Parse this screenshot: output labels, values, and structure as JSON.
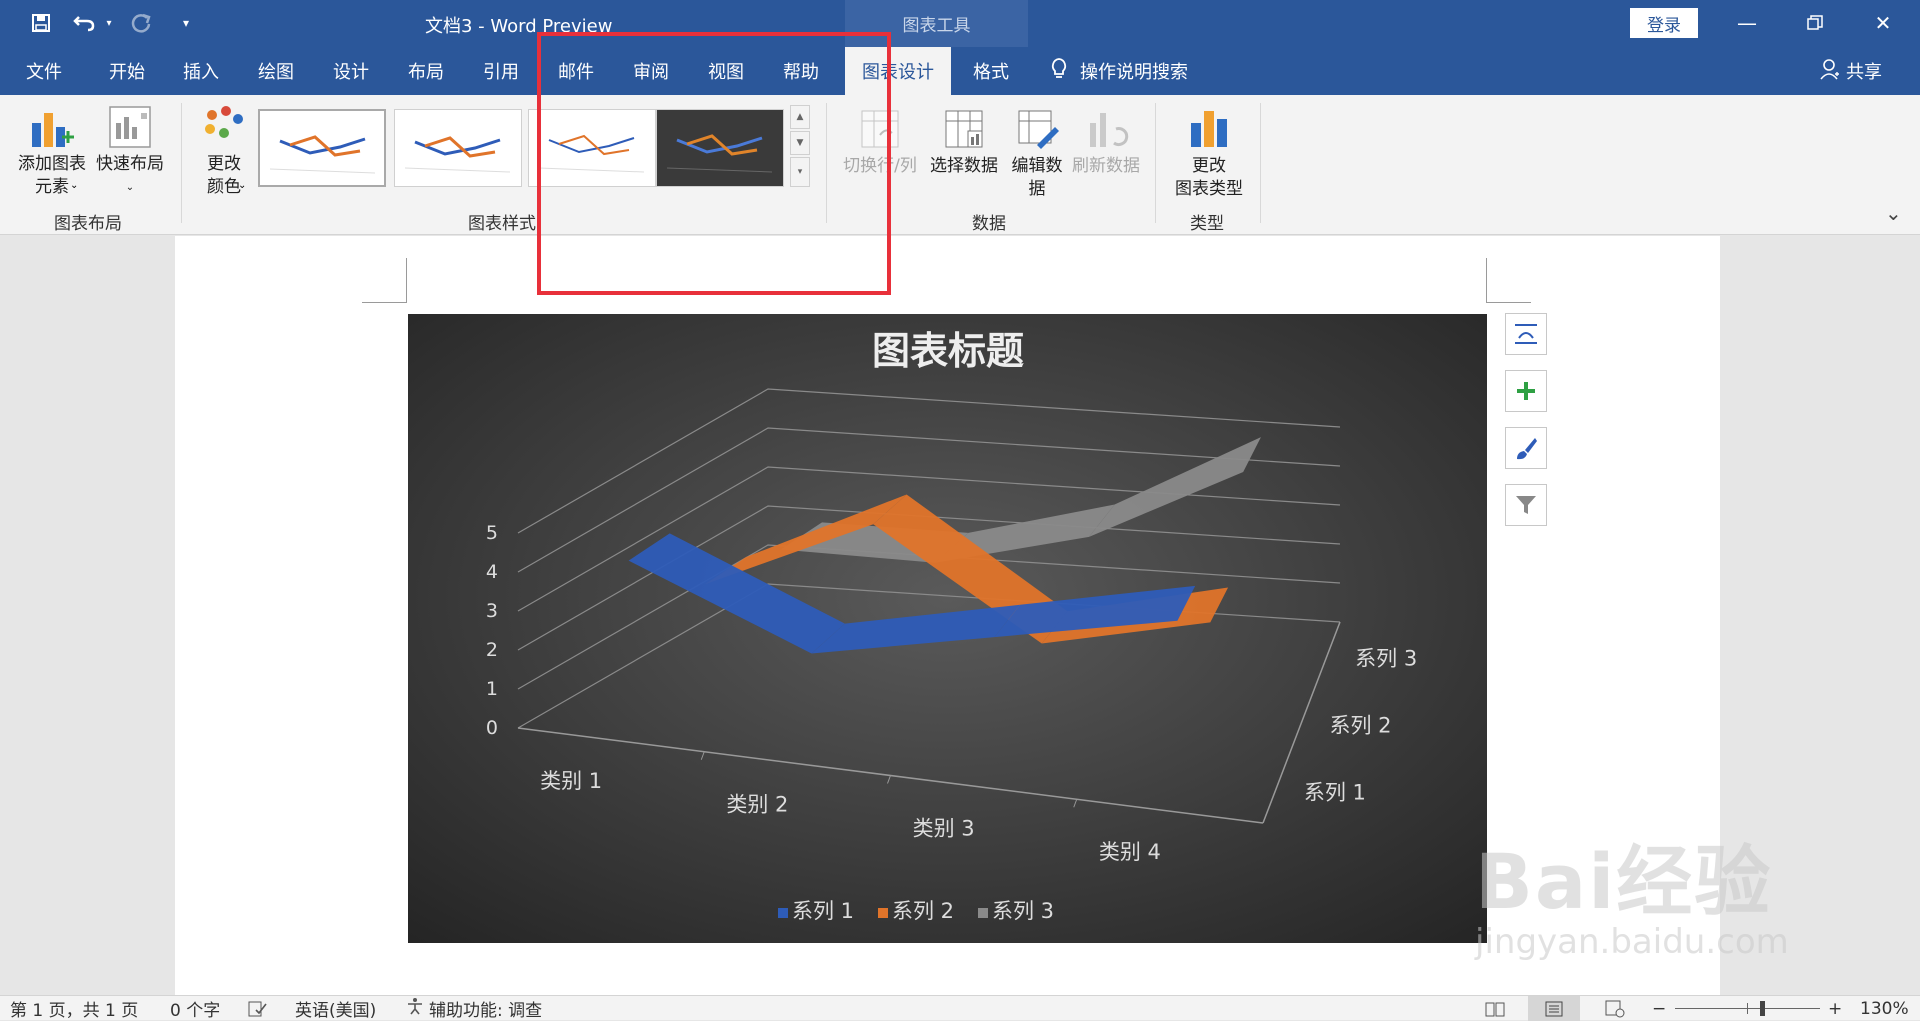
{
  "window": {
    "title": "文档3  -  Word Preview",
    "context_tab_group": "图表工具",
    "login_label": "登录"
  },
  "tabs": [
    "文件",
    "开始",
    "插入",
    "绘图",
    "设计",
    "布局",
    "引用",
    "邮件",
    "审阅",
    "视图",
    "帮助",
    "图表设计",
    "格式"
  ],
  "active_tab": "图表设计",
  "search_label": "操作说明搜索",
  "share_label": "共享",
  "ribbon": {
    "add_element": "添加图表\n元素",
    "quick_layout": "快速布局",
    "change_colors": "更改\n颜色",
    "switch_row_col": "切换行/列",
    "select_data": "选择数据",
    "edit_data": "编辑数\n据",
    "refresh_data": "刷新数据",
    "change_type": "更改\n图表类型",
    "groups": {
      "layout": "图表布局",
      "styles": "图表样式",
      "data": "数据",
      "type": "类型"
    }
  },
  "chart_data": {
    "type": "line",
    "style": "3d-ribbon",
    "title": "图表标题",
    "categories": [
      "类别 1",
      "类别 2",
      "类别 3",
      "类别 4"
    ],
    "y_ticks": [
      "0",
      "1",
      "2",
      "3",
      "4",
      "5"
    ],
    "ylim": [
      0,
      5
    ],
    "depth_labels": [
      "系列 1",
      "系列 2",
      "系列 3"
    ],
    "series": [
      {
        "name": "系列 1",
        "values": [
          4.3,
          2.5,
          3.5,
          4.5
        ],
        "color": "#2e5cb8"
      },
      {
        "name": "系列 2",
        "values": [
          2.4,
          4.4,
          1.8,
          2.8
        ],
        "color": "#e0742a"
      },
      {
        "name": "系列 3",
        "values": [
          2.0,
          2.0,
          3.0,
          5.0
        ],
        "color": "#8a8a8a"
      }
    ],
    "legend_position": "bottom"
  },
  "status": {
    "page": "第 1 页，共 1 页",
    "words": "0 个字",
    "language": "英语(美国)",
    "accessibility": "辅助功能: 调查",
    "zoom": "130%"
  },
  "watermark": {
    "text": "Bai经验",
    "sub": "jingyan.baidu.com"
  }
}
